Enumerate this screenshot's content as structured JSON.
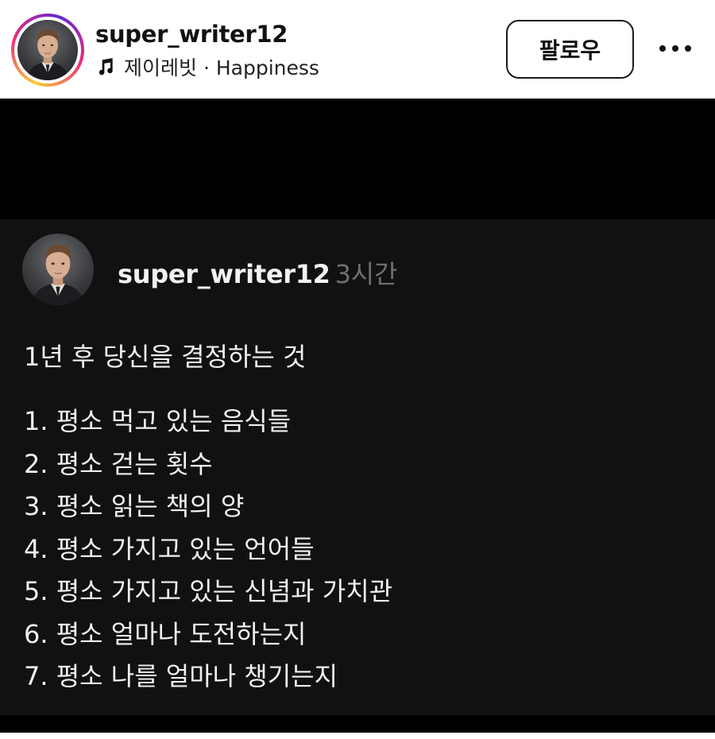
{
  "header": {
    "username": "super_writer12",
    "music": "제이레빗 · Happiness",
    "follow_label": "팔로우"
  },
  "post": {
    "username": "super_writer12",
    "time": "3시간",
    "title": "1년 후 당신을 결정하는 것",
    "items": [
      "1. 평소 먹고 있는 음식들",
      "2. 평소 걷는 횟수",
      "3. 평소 읽는 책의 양",
      "4. 평소 가지고 있는 언어들",
      "5. 평소 가지고 있는 신념과 가치관",
      "6. 평소 얼마나 도전하는지",
      "7. 평소 나를 얼마나 챙기는지"
    ]
  },
  "icons": [
    "music-note-icon",
    "more-options-icon"
  ],
  "colors": {
    "story_ring": [
      "#f9ce34",
      "#ee2a7b",
      "#6228d7"
    ],
    "card_bg": "#111111",
    "time_text": "#6f6f6f"
  }
}
